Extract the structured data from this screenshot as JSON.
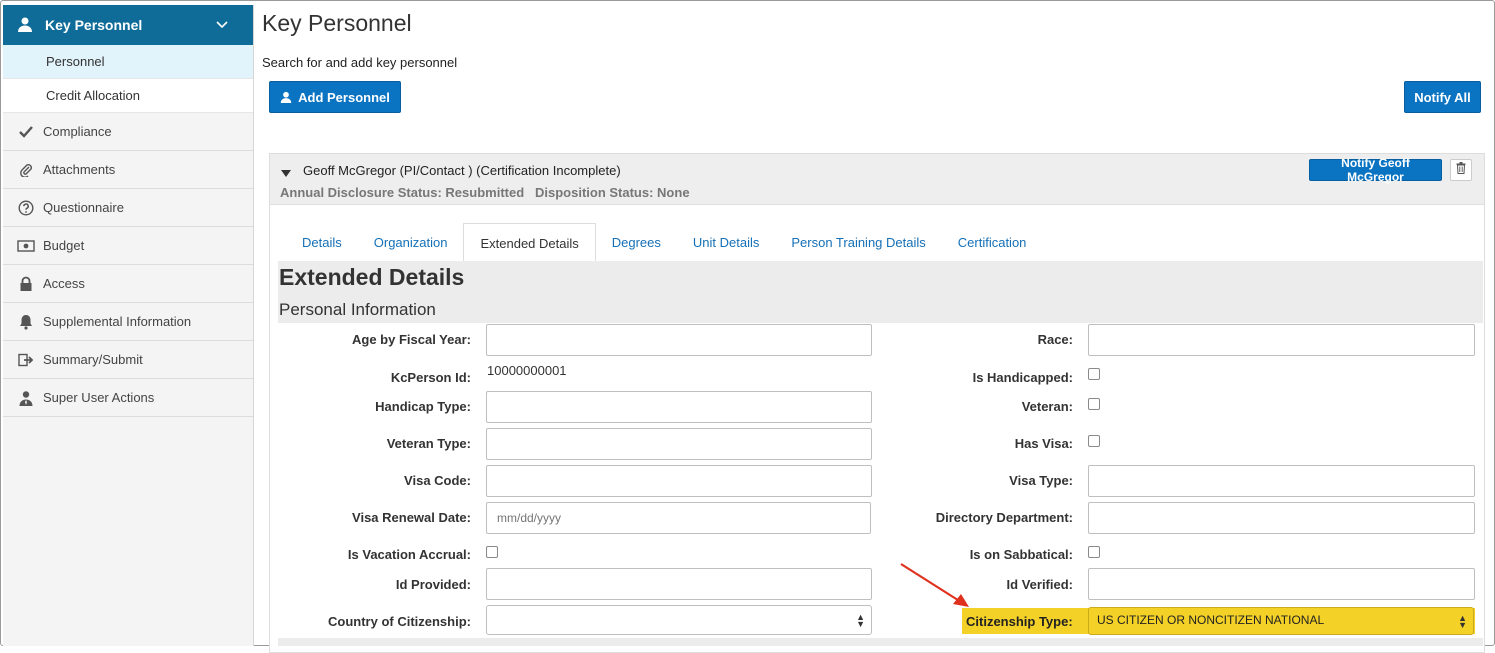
{
  "sidebar": {
    "header": "Key Personnel",
    "subitems": [
      "Personnel",
      "Credit Allocation"
    ],
    "items": [
      {
        "label": "Compliance",
        "icon": "check-icon"
      },
      {
        "label": "Attachments",
        "icon": "paperclip-icon"
      },
      {
        "label": "Questionnaire",
        "icon": "question-icon"
      },
      {
        "label": "Budget",
        "icon": "money-icon"
      },
      {
        "label": "Access",
        "icon": "lock-icon"
      },
      {
        "label": "Supplemental Information",
        "icon": "bell-icon"
      },
      {
        "label": "Summary/Submit",
        "icon": "submit-icon"
      },
      {
        "label": "Super User Actions",
        "icon": "super-user-icon"
      }
    ]
  },
  "main": {
    "title": "Key Personnel",
    "subtitle": "Search for and add key personnel",
    "add_button": "Add Personnel",
    "notify_all_button": "Notify All"
  },
  "person": {
    "name": "Geoff McGregor (PI/Contact ) (Certification Incomplete)",
    "disclosure": "Annual Disclosure Status: Resubmitted   Disposition Status: None",
    "notify_button": "Notify Geoff McGregor"
  },
  "tabs": [
    "Details",
    "Organization",
    "Extended Details",
    "Degrees",
    "Unit Details",
    "Person Training Details",
    "Certification"
  ],
  "extended": {
    "title": "Extended Details",
    "section": "Personal Information",
    "left_fields": {
      "age_by_fiscal_year": "Age by Fiscal Year:",
      "kcperson_id": "KcPerson Id:",
      "kcperson_id_value": "10000000001",
      "handicap_type": "Handicap Type:",
      "veteran_type": "Veteran Type:",
      "visa_code": "Visa Code:",
      "visa_renewal_date": "Visa Renewal Date:",
      "visa_renewal_placeholder": "mm/dd/yyyy",
      "is_vacation_accrual": "Is Vacation Accrual:",
      "id_provided": "Id Provided:",
      "country_of_citizenship": "Country of Citizenship:"
    },
    "right_fields": {
      "race": "Race:",
      "is_handicapped": "Is Handicapped:",
      "veteran": "Veteran:",
      "has_visa": "Has Visa:",
      "visa_type": "Visa Type:",
      "directory_department": "Directory Department:",
      "is_on_sabbatical": "Is on Sabbatical:",
      "id_verified": "Id Verified:",
      "citizenship_type": "Citizenship Type:",
      "citizenship_type_value": "US CITIZEN OR NONCITIZEN NATIONAL"
    }
  },
  "colors": {
    "primary": "#0a74c2",
    "sidebar_header": "#0f6b98",
    "highlight": "#f4d126",
    "annotation_arrow": "#e0301e"
  }
}
